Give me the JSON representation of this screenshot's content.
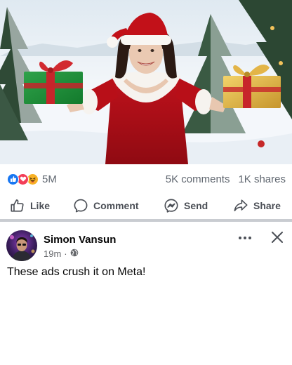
{
  "post": {
    "image_alt": "Woman in a red Santa dress holding two wrapped gift boxes in a snowy forest"
  },
  "stats": {
    "reaction_icons": [
      "like-icon",
      "love-icon",
      "haha-icon"
    ],
    "reactions_count": "5M",
    "comments": "5K comments",
    "shares": "1K shares"
  },
  "actions": {
    "like_label": "Like",
    "comment_label": "Comment",
    "send_label": "Send",
    "share_label": "Share"
  },
  "comment": {
    "author": "Simon Vansun",
    "time": "19m",
    "separator": "·",
    "privacy_icon": "globe-icon",
    "text": "These ads crush it on Meta!"
  },
  "colors": {
    "like_blue": "#1877f2",
    "love_red": "#f33e58",
    "haha_yellow": "#f7b125",
    "divider": "#c9ccd1",
    "secondary_text": "#606770"
  }
}
